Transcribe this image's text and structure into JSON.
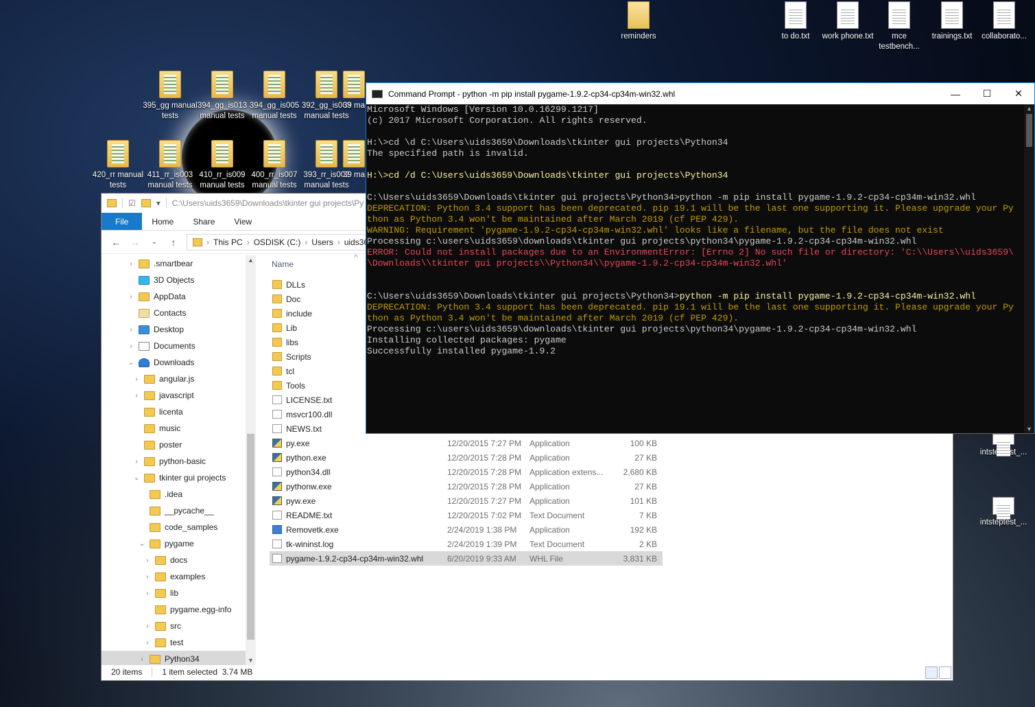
{
  "desktop": {
    "top_icons": [
      {
        "label": "reminders",
        "kind": "folder"
      },
      {
        "label": "to do.txt",
        "kind": "doc"
      },
      {
        "label": "work phone.txt",
        "kind": "doc"
      },
      {
        "label": "mce testbench...",
        "kind": "doc"
      },
      {
        "label": "trainings.txt",
        "kind": "doc"
      },
      {
        "label": "collaborato...",
        "kind": "doc"
      }
    ],
    "row1": [
      {
        "label": "395_gg manual tests"
      },
      {
        "label": "394_gg_is013 manual tests"
      },
      {
        "label": "394_gg_is005 manual tests"
      },
      {
        "label": "392_gg_is003 manual tests"
      },
      {
        "label": "39 ma"
      }
    ],
    "row2": [
      {
        "label": "420_rr manual tests"
      },
      {
        "label": "411_rr_is003 manual tests"
      },
      {
        "label": "410_rr_is009 manual tests"
      },
      {
        "label": "400_rr_is007 manual tests"
      },
      {
        "label": "393_rr_is002 manual tests"
      },
      {
        "label": "39 ma"
      }
    ],
    "right_icons": [
      {
        "label": "intsteptest_..."
      },
      {
        "label": "intsteptest_..."
      }
    ]
  },
  "explorer": {
    "qat_path": "C:\\Users\\uids3659\\Downloads\\tkinter gui projects\\Py",
    "ribbon_tabs": [
      "File",
      "Home",
      "Share",
      "View"
    ],
    "breadcrumb": [
      "This PC",
      "OSDISK (C:)",
      "Users",
      "uids365"
    ],
    "nav_items": [
      {
        "label": ".smartbear",
        "indent": 0,
        "chev": "›",
        "icon": "folder"
      },
      {
        "label": "3D Objects",
        "indent": 0,
        "chev": "",
        "icon": "cube"
      },
      {
        "label": "AppData",
        "indent": 0,
        "chev": "›",
        "icon": "folder"
      },
      {
        "label": "Contacts",
        "indent": 0,
        "chev": "",
        "icon": "contacts"
      },
      {
        "label": "Desktop",
        "indent": 0,
        "chev": "›",
        "icon": "blue"
      },
      {
        "label": "Documents",
        "indent": 0,
        "chev": "›",
        "icon": "doc"
      },
      {
        "label": "Downloads",
        "indent": 0,
        "chev": "⌄",
        "icon": "dl"
      },
      {
        "label": "angular.js",
        "indent": 1,
        "chev": "›",
        "icon": "folder"
      },
      {
        "label": "javascript",
        "indent": 1,
        "chev": "›",
        "icon": "folder"
      },
      {
        "label": "licenta",
        "indent": 1,
        "chev": "",
        "icon": "folder"
      },
      {
        "label": "music",
        "indent": 1,
        "chev": "",
        "icon": "folder"
      },
      {
        "label": "poster",
        "indent": 1,
        "chev": "",
        "icon": "folder"
      },
      {
        "label": "python-basic",
        "indent": 1,
        "chev": "›",
        "icon": "folder"
      },
      {
        "label": "tkinter gui projects",
        "indent": 1,
        "chev": "⌄",
        "icon": "folder"
      },
      {
        "label": ".idea",
        "indent": 2,
        "chev": "",
        "icon": "folder"
      },
      {
        "label": "__pycache__",
        "indent": 2,
        "chev": "",
        "icon": "folder"
      },
      {
        "label": "code_samples",
        "indent": 2,
        "chev": "",
        "icon": "folder"
      },
      {
        "label": "pygame",
        "indent": 2,
        "chev": "⌄",
        "icon": "folder"
      },
      {
        "label": "docs",
        "indent": 3,
        "chev": "›",
        "icon": "folder"
      },
      {
        "label": "examples",
        "indent": 3,
        "chev": "›",
        "icon": "folder"
      },
      {
        "label": "lib",
        "indent": 3,
        "chev": "›",
        "icon": "folder"
      },
      {
        "label": "pygame.egg-info",
        "indent": 3,
        "chev": "",
        "icon": "folder"
      },
      {
        "label": "src",
        "indent": 3,
        "chev": "›",
        "icon": "folder"
      },
      {
        "label": "test",
        "indent": 3,
        "chev": "›",
        "icon": "folder"
      },
      {
        "label": "Python34",
        "indent": 2,
        "chev": "›",
        "icon": "folder",
        "selected": true
      }
    ],
    "column_name": "Name",
    "files": [
      {
        "name": "DLLs",
        "icon": "folder",
        "date": "",
        "type": "",
        "size": ""
      },
      {
        "name": "Doc",
        "icon": "folder",
        "date": "",
        "type": "",
        "size": ""
      },
      {
        "name": "include",
        "icon": "folder",
        "date": "",
        "type": "",
        "size": ""
      },
      {
        "name": "Lib",
        "icon": "folder",
        "date": "",
        "type": "",
        "size": ""
      },
      {
        "name": "libs",
        "icon": "folder",
        "date": "",
        "type": "",
        "size": ""
      },
      {
        "name": "Scripts",
        "icon": "folder",
        "date": "",
        "type": "",
        "size": ""
      },
      {
        "name": "tcl",
        "icon": "folder",
        "date": "",
        "type": "",
        "size": ""
      },
      {
        "name": "Tools",
        "icon": "folder",
        "date": "",
        "type": "",
        "size": ""
      },
      {
        "name": "LICENSE.txt",
        "icon": "file",
        "date": "",
        "type": "",
        "size": ""
      },
      {
        "name": "msvcr100.dll",
        "icon": "file",
        "date": "",
        "type": "",
        "size": ""
      },
      {
        "name": "NEWS.txt",
        "icon": "file",
        "date": "",
        "type": "",
        "size": ""
      },
      {
        "name": "py.exe",
        "icon": "py",
        "date": "12/20/2015 7:27 PM",
        "type": "Application",
        "size": "100 KB"
      },
      {
        "name": "python.exe",
        "icon": "py",
        "date": "12/20/2015 7:28 PM",
        "type": "Application",
        "size": "27 KB"
      },
      {
        "name": "python34.dll",
        "icon": "file",
        "date": "12/20/2015 7:28 PM",
        "type": "Application extens...",
        "size": "2,680 KB"
      },
      {
        "name": "pythonw.exe",
        "icon": "py",
        "date": "12/20/2015 7:28 PM",
        "type": "Application",
        "size": "27 KB"
      },
      {
        "name": "pyw.exe",
        "icon": "py",
        "date": "12/20/2015 7:27 PM",
        "type": "Application",
        "size": "101 KB"
      },
      {
        "name": "README.txt",
        "icon": "file",
        "date": "12/20/2015 7:02 PM",
        "type": "Text Document",
        "size": "7 KB"
      },
      {
        "name": "Removetk.exe",
        "icon": "exe",
        "date": "2/24/2019 1:38 PM",
        "type": "Application",
        "size": "192 KB"
      },
      {
        "name": "tk-wininst.log",
        "icon": "file",
        "date": "2/24/2019 1:39 PM",
        "type": "Text Document",
        "size": "2 KB"
      },
      {
        "name": "pygame-1.9.2-cp34-cp34m-win32.whl",
        "icon": "file",
        "date": "6/20/2019 9:33 AM",
        "type": "WHL File",
        "size": "3,831 KB",
        "selected": true
      }
    ],
    "status": {
      "count": "20 items",
      "selection": "1 item selected  3.74 MB"
    }
  },
  "cmd": {
    "title": "Command Prompt - python  -m pip install pygame-1.9.2-cp34-cp34m-win32.whl",
    "lines": [
      {
        "t": "Microsoft Windows [Version 10.0.16299.1217]",
        "c": ""
      },
      {
        "t": "(c) 2017 Microsoft Corporation. All rights reserved.",
        "c": ""
      },
      {
        "t": "",
        "c": ""
      },
      {
        "t": "H:\\>cd \\d C:\\Users\\uids3659\\Downloads\\tkinter gui projects\\Python34",
        "c": ""
      },
      {
        "t": "The specified path is invalid.",
        "c": ""
      },
      {
        "t": "",
        "c": ""
      },
      {
        "t": "H:\\>cd /d C:\\Users\\uids3659\\Downloads\\tkinter gui projects\\Python34",
        "c": "hl"
      },
      {
        "t": "",
        "c": ""
      },
      {
        "t": "C:\\Users\\uids3659\\Downloads\\tkinter gui projects\\Python34>python -m pip install pygame-1.9.2-cp34-cp34m-win32.whl",
        "c": ""
      },
      {
        "t": "DEPRECATION: Python 3.4 support has been deprecated. pip 19.1 will be the last one supporting it. Please upgrade your Py",
        "c": "y"
      },
      {
        "t": "thon as Python 3.4 won't be maintained after March 2019 (cf PEP 429).",
        "c": "y"
      },
      {
        "t": "WARNING: Requirement 'pygame-1.9.2-cp34-cp34m-win32.whl' looks like a filename, but the file does not exist",
        "c": "y"
      },
      {
        "t": "Processing c:\\users\\uids3659\\downloads\\tkinter gui projects\\python34\\pygame-1.9.2-cp34-cp34m-win32.whl",
        "c": ""
      },
      {
        "t": "ERROR: Could not install packages due to an EnvironmentError: [Errno 2] No such file or directory: 'C:\\\\Users\\\\uids3659\\",
        "c": "r"
      },
      {
        "t": "\\Downloads\\\\tkinter gui projects\\\\Python34\\\\pygame-1.9.2-cp34-cp34m-win32.whl'",
        "c": "r"
      },
      {
        "t": "",
        "c": ""
      },
      {
        "t": "",
        "c": ""
      },
      {
        "t": "C:\\Users\\uids3659\\Downloads\\tkinter gui projects\\Python34>python -m pip install pygame-1.9.2-cp34-cp34m-win32.whl",
        "c": "hl2"
      },
      {
        "t": "DEPRECATION: Python 3.4 support has been deprecated. pip 19.1 will be the last one supporting it. Please upgrade your Py",
        "c": "y"
      },
      {
        "t": "thon as Python 3.4 won't be maintained after March 2019 (cf PEP 429).",
        "c": "y"
      },
      {
        "t": "Processing c:\\users\\uids3659\\downloads\\tkinter gui projects\\python34\\pygame-1.9.2-cp34-cp34m-win32.whl",
        "c": ""
      },
      {
        "t": "Installing collected packages: pygame",
        "c": ""
      },
      {
        "t": "Successfully installed pygame-1.9.2",
        "c": ""
      }
    ]
  }
}
